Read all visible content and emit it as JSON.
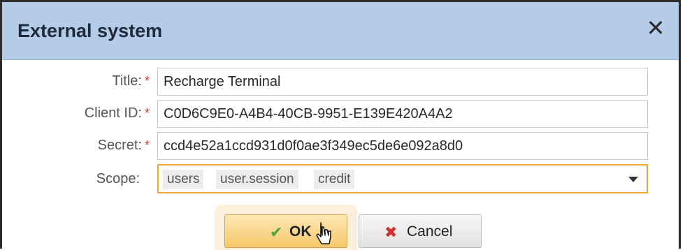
{
  "dialog": {
    "title": "External system",
    "close_glyph": "✕"
  },
  "form": {
    "title_label": "Title:",
    "title_value": "Recharge Terminal",
    "client_id_label": "Client ID:",
    "client_id_value": "C0D6C9E0-A4B4-40CB-9951-E139E420A4A2",
    "secret_label": "Secret:",
    "secret_value": "ccd4e52a1ccd931d0f0ae3f349ec5de6e092a8d0",
    "scope_label": "Scope:",
    "scope_tags": [
      "users",
      "user.session",
      "credit"
    ],
    "required_mark": "*"
  },
  "buttons": {
    "ok_label": "OK",
    "ok_icon": "✔",
    "cancel_label": "Cancel",
    "cancel_icon": "✖"
  },
  "colors": {
    "titlebar": "#b5cce9",
    "focus_border": "#f0a73a",
    "required": "#d23a3a",
    "ok_check": "#4aa63a",
    "cancel_x": "#d23030"
  },
  "icons": [
    "close-icon",
    "checkmark-icon",
    "cancel-x-icon",
    "dropdown-caret-icon",
    "mouse-pointer-icon"
  ]
}
